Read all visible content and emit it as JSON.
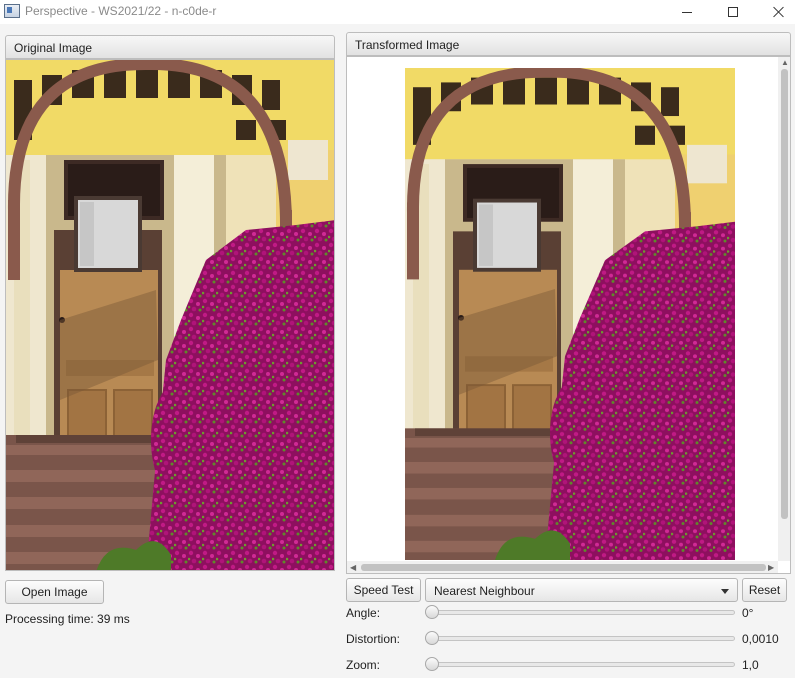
{
  "window": {
    "title": "Perspective - WS2021/22 - n-c0de-r"
  },
  "left_panel": {
    "header": "Original Image",
    "image_alt": "Photo of a door with a brown arch and magenta bougainvillea flowers"
  },
  "right_panel": {
    "header": "Transformed Image",
    "image_alt": "Transformed photo of a door with a brown arch and magenta bougainvillea flowers"
  },
  "controls": {
    "open_button": "Open Image",
    "speed_button": "Speed Test",
    "interpolation_selected": "Nearest Neighbour",
    "reset_button": "Reset",
    "processing_time": "Processing time: 39 ms"
  },
  "sliders": [
    {
      "label": "Angle:",
      "value": "0°",
      "level": 0
    },
    {
      "label": "Distortion:",
      "value": "0,0010",
      "level": 0
    },
    {
      "label": "Zoom:",
      "value": "1,0",
      "level": 0
    }
  ],
  "colors": {
    "flowers": "#a3126e",
    "door": "#b58a55",
    "arch": "#8a5a4c",
    "wall": "#f1e6b0",
    "steps": "#7e5a4e"
  }
}
